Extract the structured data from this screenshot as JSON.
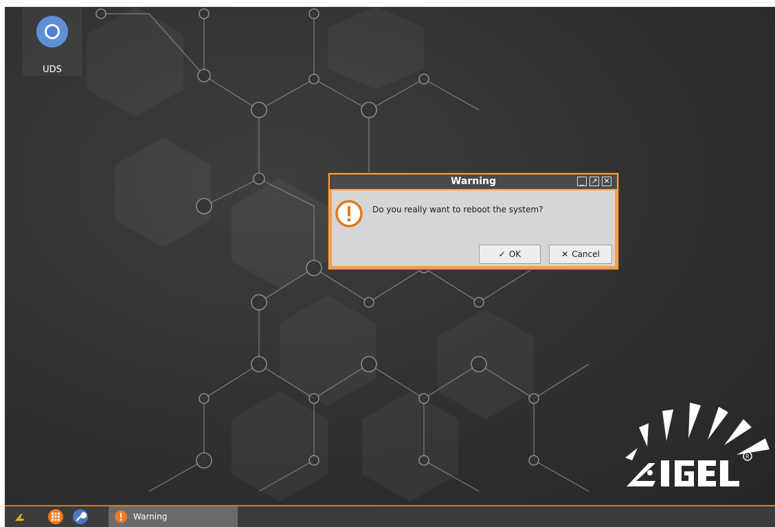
{
  "desktop": {
    "icons": [
      {
        "label": "UDS",
        "icon": "chromium-icon"
      }
    ],
    "logo": {
      "text": "IGEL",
      "registered_mark": "®"
    }
  },
  "dialog": {
    "title": "Warning",
    "message": "Do you really want to reboot the system?",
    "ok_label": "OK",
    "cancel_label": "Cancel",
    "controls": [
      "minimize-icon",
      "maximize-icon",
      "close-icon"
    ]
  },
  "taskbar": {
    "items": [
      {
        "icon": "igel-start-icon"
      },
      {
        "icon": "app-menu-grid-icon"
      },
      {
        "icon": "wrench-icon"
      }
    ],
    "tasks": [
      {
        "label": "Warning",
        "icon": "warning-icon"
      }
    ]
  },
  "colors": {
    "accent": "#e07a1c",
    "desktop_bg": "#333333",
    "taskbar_bg": "#3c3c3c",
    "dialog_border": "#f0a050"
  }
}
